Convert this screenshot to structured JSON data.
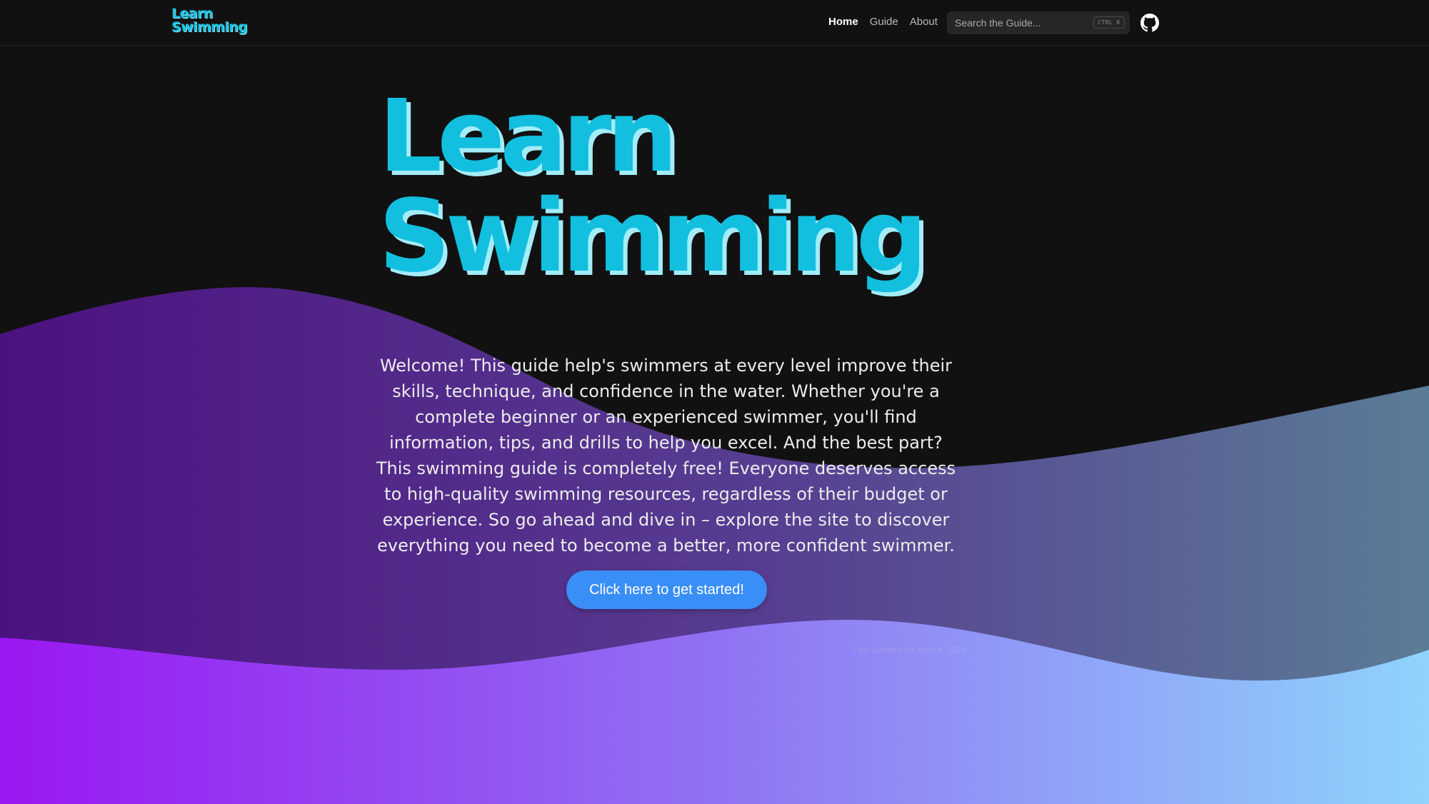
{
  "brand": {
    "logo_line1": "Learn",
    "logo_line2": "Swimming",
    "accent_color": "#12bfdf"
  },
  "nav": {
    "links": [
      {
        "label": "Home",
        "active": true
      },
      {
        "label": "Guide",
        "active": false
      },
      {
        "label": "About",
        "active": false
      }
    ],
    "search": {
      "placeholder": "Search the Guide...",
      "shortcut": "CTRL K"
    },
    "github_icon": "github-icon"
  },
  "hero": {
    "title_line1": "Learn",
    "title_line2": "Swimming",
    "intro": "Welcome! This guide help's swimmers at every level improve their skills, technique, and confidence in the water. Whether you're a complete beginner or an experienced swimmer, you'll find information, tips, and drills to help you excel. And the best part? This swimming guide is completely free! Everyone deserves access to high-quality swimming resources, regardless of their budget or experience. So go ahead and dive in – explore the site to discover everything you need to become a better, more confident swimmer.",
    "cta_label": "Click here to get started!",
    "cta_color": "#3a8ef7"
  },
  "footer": {
    "last_updated": "Last updated on June 4, 2025"
  },
  "colors": {
    "background": "#111111",
    "wave_top_left": "#4c1180",
    "wave_top_right": "#5b7c96",
    "wave_bottom_left": "#9a17f2",
    "wave_bottom_right": "#8fd3fc"
  }
}
